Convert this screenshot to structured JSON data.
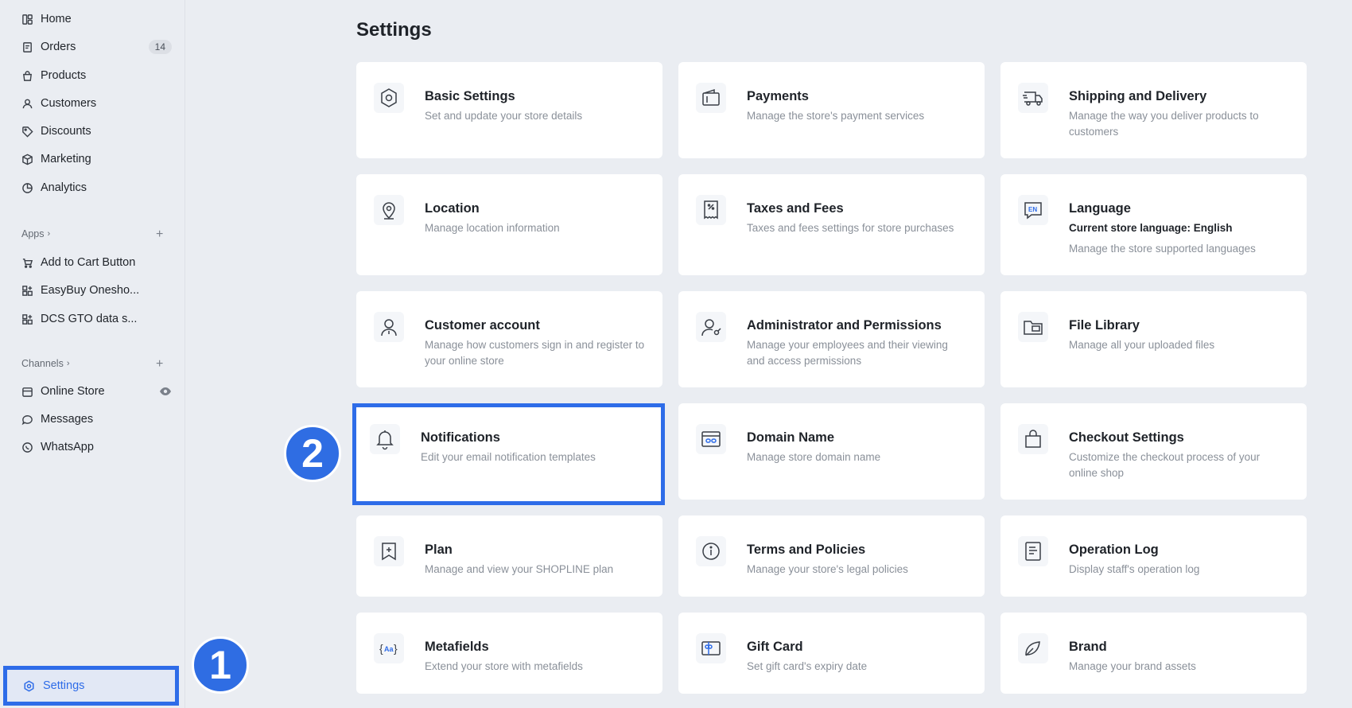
{
  "sidebar": {
    "items": [
      {
        "label": "Home",
        "icon": "home-icon"
      },
      {
        "label": "Orders",
        "icon": "orders-icon",
        "badge": "14"
      },
      {
        "label": "Products",
        "icon": "products-icon"
      },
      {
        "label": "Customers",
        "icon": "customers-icon"
      },
      {
        "label": "Discounts",
        "icon": "discounts-icon"
      },
      {
        "label": "Marketing",
        "icon": "marketing-icon"
      },
      {
        "label": "Analytics",
        "icon": "analytics-icon"
      }
    ],
    "apps_label": "Apps",
    "apps": [
      {
        "label": "Add to Cart Button"
      },
      {
        "label": "EasyBuy Onesho..."
      },
      {
        "label": "DCS GTO data s..."
      }
    ],
    "channels_label": "Channels",
    "channels": [
      {
        "label": "Online Store"
      },
      {
        "label": "Messages"
      },
      {
        "label": "WhatsApp"
      }
    ],
    "settings_label": "Settings"
  },
  "annotations": {
    "step1": "1",
    "step2": "2"
  },
  "main": {
    "title": "Settings",
    "cards": [
      {
        "title": "Basic Settings",
        "desc": "Set and update your store details"
      },
      {
        "title": "Payments",
        "desc": "Manage the store's payment services"
      },
      {
        "title": "Shipping and Delivery",
        "desc": "Manage the way you deliver products to customers"
      },
      {
        "title": "Location",
        "desc": "Manage location information"
      },
      {
        "title": "Taxes and Fees",
        "desc": "Taxes and fees settings for store purchases"
      },
      {
        "title": "Language",
        "desc": "Current store language: English",
        "desc2": "Manage the store supported languages"
      },
      {
        "title": "Customer account",
        "desc": "Manage how customers sign in and register to your online store"
      },
      {
        "title": "Administrator and Permissions",
        "desc": "Manage your employees and their viewing and access permissions"
      },
      {
        "title": "File Library",
        "desc": "Manage all your uploaded files"
      },
      {
        "title": "Notifications",
        "desc": "Edit your email notification templates"
      },
      {
        "title": "Domain Name",
        "desc": "Manage store domain name"
      },
      {
        "title": "Checkout Settings",
        "desc": "Customize the checkout process of your online shop"
      },
      {
        "title": "Plan",
        "desc": "Manage and view your SHOPLINE plan"
      },
      {
        "title": "Terms and Policies",
        "desc": "Manage your store's legal policies"
      },
      {
        "title": "Operation Log",
        "desc": "Display staff's operation log"
      },
      {
        "title": "Metafields",
        "desc": "Extend your store with metafields"
      },
      {
        "title": "Gift Card",
        "desc": "Set gift card's expiry date"
      },
      {
        "title": "Brand",
        "desc": "Manage your brand assets"
      }
    ]
  },
  "colors": {
    "accent": "#2e6ce8",
    "background": "#eaedf2",
    "card": "#ffffff"
  }
}
